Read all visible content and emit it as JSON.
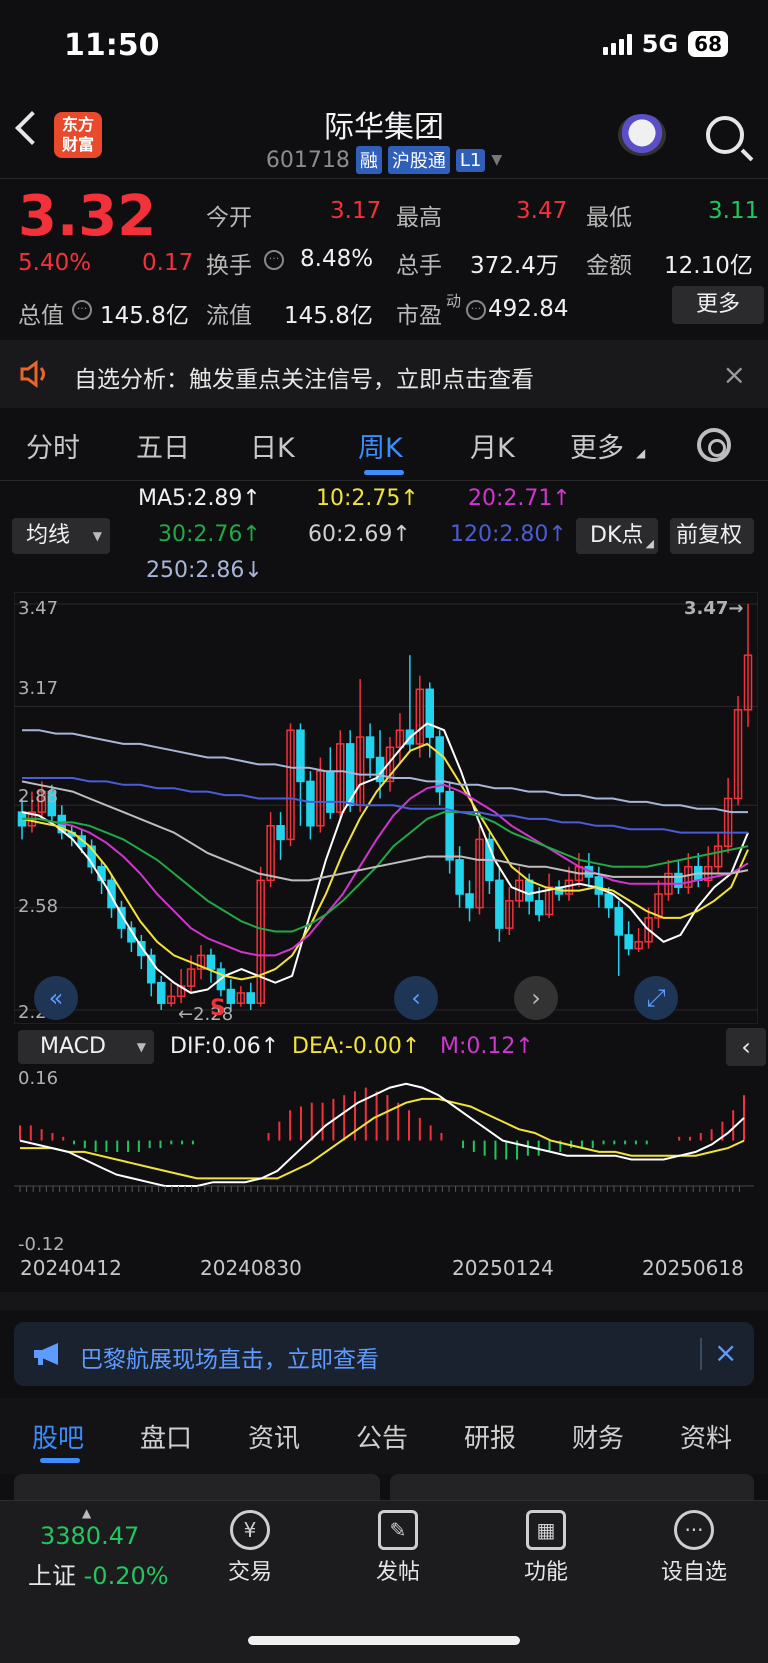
{
  "status": {
    "time": "11:50",
    "network": "5G",
    "battery": "68"
  },
  "header": {
    "logo_line1": "东方",
    "logo_line2": "财富",
    "title": "际华集团",
    "code": "601718",
    "tags": [
      "融",
      "沪股通",
      "L1"
    ]
  },
  "quote": {
    "price": "3.32",
    "change_pct": "5.40%",
    "change": "0.17",
    "labels": {
      "open": "今开",
      "high": "最高",
      "low": "最低",
      "turnover": "换手",
      "volume": "总手",
      "amount": "金额",
      "mktcap": "总值",
      "float": "流值",
      "pe": "市盈",
      "pe_sup": "动"
    },
    "open": "3.17",
    "high": "3.47",
    "low": "3.11",
    "turnover": "8.48%",
    "volume": "372.4万",
    "amount": "12.10亿",
    "mktcap": "145.8亿",
    "float": "145.8亿",
    "pe": "492.84",
    "more_label": "更多"
  },
  "notice": {
    "text": "自选分析：触发重点关注信号，立即点击查看",
    "close": "×"
  },
  "tabs": [
    "分时",
    "五日",
    "日K",
    "周K",
    "月K",
    "更多"
  ],
  "legend": {
    "selector": "均线",
    "ma5": "MA5:2.89↑",
    "ma10": "10:2.75↑",
    "ma20": "20:2.71↑",
    "ma30": "30:2.76↑",
    "ma60": "60:2.69↑",
    "ma120": "120:2.80↑",
    "ma250": "250:2.86↓",
    "dk_label": "DK点",
    "fq_label": "前复权"
  },
  "chart_data": {
    "type": "candlestick",
    "yticks": [
      "3.47",
      "3.17",
      "2.88",
      "2.58",
      "2.28"
    ],
    "ylim": [
      2.28,
      3.47
    ],
    "max_label": "3.47→",
    "min_label": "←2.28",
    "marker": "S",
    "candles": [
      [
        2.86,
        2.82,
        2.9,
        2.78
      ],
      [
        2.82,
        2.86,
        2.92,
        2.8
      ],
      [
        2.86,
        2.92,
        2.95,
        2.84
      ],
      [
        2.92,
        2.85,
        2.94,
        2.82
      ],
      [
        2.85,
        2.8,
        2.88,
        2.78
      ],
      [
        2.8,
        2.79,
        2.82,
        2.76
      ],
      [
        2.79,
        2.76,
        2.81,
        2.74
      ],
      [
        2.76,
        2.7,
        2.78,
        2.68
      ],
      [
        2.7,
        2.66,
        2.72,
        2.62
      ],
      [
        2.66,
        2.58,
        2.68,
        2.55
      ],
      [
        2.58,
        2.52,
        2.6,
        2.49
      ],
      [
        2.52,
        2.48,
        2.54,
        2.45
      ],
      [
        2.48,
        2.44,
        2.5,
        2.4
      ],
      [
        2.44,
        2.36,
        2.46,
        2.32
      ],
      [
        2.36,
        2.3,
        2.38,
        2.28
      ],
      [
        2.3,
        2.32,
        2.36,
        2.29
      ],
      [
        2.32,
        2.35,
        2.4,
        2.3
      ],
      [
        2.35,
        2.4,
        2.44,
        2.33
      ],
      [
        2.4,
        2.44,
        2.47,
        2.37
      ],
      [
        2.44,
        2.4,
        2.46,
        2.36
      ],
      [
        2.4,
        2.34,
        2.42,
        2.32
      ],
      [
        2.34,
        2.3,
        2.37,
        2.28
      ],
      [
        2.3,
        2.33,
        2.35,
        2.29
      ],
      [
        2.33,
        2.3,
        2.36,
        2.28
      ],
      [
        2.3,
        2.66,
        2.7,
        2.29
      ],
      [
        2.66,
        2.82,
        2.86,
        2.64
      ],
      [
        2.82,
        2.78,
        2.86,
        2.72
      ],
      [
        2.78,
        3.1,
        3.12,
        2.76
      ],
      [
        3.1,
        2.95,
        3.12,
        2.82
      ],
      [
        2.95,
        2.82,
        2.98,
        2.78
      ],
      [
        2.82,
        2.98,
        3.02,
        2.8
      ],
      [
        2.98,
        2.86,
        3.05,
        2.84
      ],
      [
        2.86,
        3.06,
        3.1,
        2.84
      ],
      [
        3.06,
        2.88,
        3.1,
        2.86
      ],
      [
        2.88,
        3.08,
        3.25,
        2.86
      ],
      [
        3.08,
        3.02,
        3.12,
        2.96
      ],
      [
        3.02,
        2.95,
        3.1,
        2.9
      ],
      [
        2.95,
        3.05,
        3.08,
        2.92
      ],
      [
        3.05,
        3.1,
        3.15,
        3.0
      ],
      [
        3.1,
        3.06,
        3.32,
        3.04
      ],
      [
        3.06,
        3.22,
        3.26,
        3.02
      ],
      [
        3.22,
        3.08,
        3.24,
        3.02
      ],
      [
        3.08,
        2.92,
        3.1,
        2.88
      ],
      [
        2.92,
        2.72,
        2.95,
        2.68
      ],
      [
        2.72,
        2.62,
        2.76,
        2.58
      ],
      [
        2.62,
        2.58,
        2.66,
        2.54
      ],
      [
        2.58,
        2.78,
        2.82,
        2.56
      ],
      [
        2.78,
        2.66,
        2.8,
        2.62
      ],
      [
        2.66,
        2.52,
        2.7,
        2.48
      ],
      [
        2.52,
        2.6,
        2.64,
        2.5
      ],
      [
        2.6,
        2.66,
        2.7,
        2.58
      ],
      [
        2.66,
        2.6,
        2.68,
        2.56
      ],
      [
        2.6,
        2.56,
        2.64,
        2.54
      ],
      [
        2.56,
        2.64,
        2.68,
        2.55
      ],
      [
        2.64,
        2.62,
        2.66,
        2.6
      ],
      [
        2.62,
        2.66,
        2.7,
        2.6
      ],
      [
        2.66,
        2.7,
        2.74,
        2.64
      ],
      [
        2.7,
        2.67,
        2.74,
        2.64
      ],
      [
        2.67,
        2.62,
        2.7,
        2.58
      ],
      [
        2.62,
        2.58,
        2.64,
        2.55
      ],
      [
        2.58,
        2.5,
        2.6,
        2.38
      ],
      [
        2.5,
        2.46,
        2.54,
        2.44
      ],
      [
        2.46,
        2.48,
        2.52,
        2.45
      ],
      [
        2.48,
        2.55,
        2.58,
        2.46
      ],
      [
        2.55,
        2.62,
        2.66,
        2.52
      ],
      [
        2.62,
        2.68,
        2.72,
        2.6
      ],
      [
        2.68,
        2.64,
        2.72,
        2.62
      ],
      [
        2.64,
        2.7,
        2.74,
        2.62
      ],
      [
        2.7,
        2.66,
        2.74,
        2.64
      ],
      [
        2.66,
        2.7,
        2.76,
        2.64
      ],
      [
        2.7,
        2.76,
        2.8,
        2.68
      ],
      [
        2.76,
        2.9,
        2.96,
        2.74
      ],
      [
        2.9,
        3.16,
        3.2,
        2.88
      ],
      [
        3.16,
        3.32,
        3.47,
        3.11
      ]
    ],
    "ma": {
      "ma5": {
        "color": "#ffffff",
        "points": [
          2.86,
          2.85,
          2.82,
          2.78,
          2.72,
          2.64,
          2.55,
          2.47,
          2.4,
          2.36,
          2.33,
          2.34,
          2.38,
          2.4,
          2.38,
          2.36,
          2.38,
          2.55,
          2.72,
          2.86,
          2.94,
          2.96,
          3.02,
          3.08,
          3.12,
          3.1,
          2.98,
          2.84,
          2.72,
          2.64,
          2.62,
          2.63,
          2.64,
          2.65,
          2.64,
          2.62,
          2.58,
          2.52,
          2.48,
          2.5,
          2.58,
          2.64,
          2.68,
          2.8
        ]
      },
      "ma10": {
        "color": "#f2e33b",
        "points": [
          2.84,
          2.83,
          2.82,
          2.8,
          2.76,
          2.7,
          2.62,
          2.54,
          2.48,
          2.44,
          2.42,
          2.4,
          2.38,
          2.37,
          2.38,
          2.4,
          2.44,
          2.52,
          2.62,
          2.74,
          2.84,
          2.92,
          2.98,
          3.04,
          3.06,
          3.02,
          2.94,
          2.86,
          2.78,
          2.7,
          2.66,
          2.64,
          2.63,
          2.63,
          2.64,
          2.63,
          2.6,
          2.57,
          2.55,
          2.55,
          2.57,
          2.6,
          2.64,
          2.75
        ]
      },
      "ma20": {
        "color": "#d035d0",
        "points": [
          2.84,
          2.84,
          2.83,
          2.82,
          2.8,
          2.77,
          2.73,
          2.68,
          2.62,
          2.57,
          2.52,
          2.49,
          2.47,
          2.45,
          2.44,
          2.44,
          2.46,
          2.5,
          2.56,
          2.62,
          2.7,
          2.78,
          2.85,
          2.9,
          2.93,
          2.94,
          2.92,
          2.89,
          2.86,
          2.82,
          2.79,
          2.76,
          2.73,
          2.7,
          2.68,
          2.66,
          2.65,
          2.65,
          2.65,
          2.65,
          2.66,
          2.67,
          2.68,
          2.71
        ]
      },
      "ma30": {
        "color": "#22a845",
        "points": [
          2.84,
          2.84,
          2.83,
          2.83,
          2.82,
          2.8,
          2.78,
          2.75,
          2.72,
          2.68,
          2.64,
          2.6,
          2.57,
          2.54,
          2.52,
          2.51,
          2.51,
          2.53,
          2.56,
          2.6,
          2.65,
          2.7,
          2.76,
          2.8,
          2.84,
          2.86,
          2.86,
          2.85,
          2.83,
          2.8,
          2.78,
          2.76,
          2.74,
          2.72,
          2.71,
          2.7,
          2.7,
          2.7,
          2.71,
          2.72,
          2.73,
          2.74,
          2.75,
          2.76
        ]
      },
      "ma60": {
        "color": "#bdbdbd",
        "points": [
          2.95,
          2.94,
          2.93,
          2.92,
          2.9,
          2.88,
          2.86,
          2.84,
          2.82,
          2.8,
          2.77,
          2.74,
          2.72,
          2.7,
          2.68,
          2.67,
          2.66,
          2.66,
          2.67,
          2.68,
          2.69,
          2.7,
          2.71,
          2.72,
          2.73,
          2.73,
          2.73,
          2.72,
          2.72,
          2.71,
          2.7,
          2.7,
          2.69,
          2.68,
          2.68,
          2.67,
          2.67,
          2.67,
          2.67,
          2.67,
          2.68,
          2.68,
          2.68,
          2.69
        ]
      },
      "ma120": {
        "color": "#4a5cd8",
        "points": [
          2.96,
          2.96,
          2.96,
          2.96,
          2.95,
          2.95,
          2.94,
          2.94,
          2.93,
          2.93,
          2.92,
          2.92,
          2.91,
          2.91,
          2.9,
          2.9,
          2.9,
          2.89,
          2.89,
          2.89,
          2.88,
          2.88,
          2.88,
          2.87,
          2.87,
          2.87,
          2.86,
          2.86,
          2.85,
          2.85,
          2.84,
          2.84,
          2.83,
          2.83,
          2.82,
          2.82,
          2.81,
          2.81,
          2.81,
          2.8,
          2.8,
          2.8,
          2.8,
          2.8
        ]
      },
      "ma250": {
        "color": "#a7b6d8",
        "points": [
          3.1,
          3.1,
          3.09,
          3.09,
          3.08,
          3.07,
          3.06,
          3.06,
          3.05,
          3.04,
          3.03,
          3.02,
          3.02,
          3.01,
          3.0,
          3.0,
          2.99,
          2.99,
          2.98,
          2.98,
          2.97,
          2.97,
          2.96,
          2.96,
          2.95,
          2.95,
          2.94,
          2.94,
          2.93,
          2.93,
          2.92,
          2.92,
          2.91,
          2.91,
          2.9,
          2.9,
          2.89,
          2.89,
          2.88,
          2.88,
          2.87,
          2.87,
          2.86,
          2.86
        ]
      }
    }
  },
  "macd": {
    "selector": "MACD",
    "dif": "DIF:0.06↑",
    "dea": "DEA:-0.00↑",
    "m": "M:0.12↑",
    "yticks": [
      "0.16",
      "-0.12"
    ],
    "ylim": [
      -0.12,
      0.16
    ],
    "hist": [
      0.04,
      0.04,
      0.03,
      0.02,
      0.01,
      -0.01,
      -0.02,
      -0.03,
      -0.03,
      -0.03,
      -0.03,
      -0.03,
      -0.02,
      -0.02,
      -0.01,
      -0.01,
      -0.01,
      0.0,
      0.0,
      0.0,
      0.0,
      0.0,
      0.0,
      0.02,
      0.05,
      0.08,
      0.09,
      0.1,
      0.1,
      0.11,
      0.12,
      0.13,
      0.14,
      0.13,
      0.12,
      0.1,
      0.08,
      0.06,
      0.04,
      0.02,
      0.0,
      -0.02,
      -0.03,
      -0.04,
      -0.05,
      -0.05,
      -0.05,
      -0.04,
      -0.04,
      -0.03,
      -0.03,
      -0.02,
      -0.02,
      -0.02,
      -0.01,
      -0.01,
      -0.01,
      -0.01,
      -0.01,
      0.0,
      0.0,
      0.01,
      0.01,
      0.02,
      0.03,
      0.05,
      0.08,
      0.12
    ],
    "dif_line": [
      0.0,
      -0.01,
      -0.02,
      -0.03,
      -0.05,
      -0.07,
      -0.09,
      -0.1,
      -0.11,
      -0.12,
      -0.12,
      -0.12,
      -0.11,
      -0.11,
      -0.11,
      -0.1,
      -0.08,
      -0.04,
      0.0,
      0.04,
      0.07,
      0.1,
      0.12,
      0.14,
      0.15,
      0.14,
      0.12,
      0.09,
      0.06,
      0.03,
      0.0,
      -0.01,
      -0.02,
      -0.03,
      -0.04,
      -0.04,
      -0.04,
      -0.04,
      -0.05,
      -0.05,
      -0.05,
      -0.04,
      -0.03,
      -0.01,
      0.02,
      0.06
    ],
    "dea_line": [
      -0.02,
      -0.02,
      -0.02,
      -0.03,
      -0.03,
      -0.04,
      -0.05,
      -0.06,
      -0.07,
      -0.08,
      -0.09,
      -0.1,
      -0.1,
      -0.1,
      -0.1,
      -0.1,
      -0.1,
      -0.08,
      -0.06,
      -0.03,
      0.0,
      0.03,
      0.06,
      0.08,
      0.1,
      0.11,
      0.11,
      0.1,
      0.09,
      0.07,
      0.05,
      0.03,
      0.02,
      0.0,
      -0.01,
      -0.02,
      -0.03,
      -0.03,
      -0.04,
      -0.04,
      -0.04,
      -0.04,
      -0.04,
      -0.03,
      -0.02,
      0.0
    ]
  },
  "dates": [
    "20240412",
    "20240830",
    "20250124",
    "20250618"
  ],
  "ad": {
    "text": "巴黎航展现场直击，立即查看",
    "close": "×"
  },
  "bottom_tabs": [
    "股吧",
    "盘口",
    "资讯",
    "公告",
    "研报",
    "财务",
    "资料"
  ],
  "navbar": {
    "index_value": "3380.47",
    "index_name": "上证",
    "index_change": "-0.20%",
    "items": [
      {
        "label": "交易",
        "icon": "yen-cycle-icon"
      },
      {
        "label": "发帖",
        "icon": "edit-icon"
      },
      {
        "label": "功能",
        "icon": "grid-icon"
      },
      {
        "label": "设自选",
        "icon": "more-icon"
      }
    ]
  },
  "colors": {
    "up": "#f2313b",
    "down": "#22d3ee",
    "accent": "#3b8cff",
    "macd_down": "#22c55e"
  }
}
